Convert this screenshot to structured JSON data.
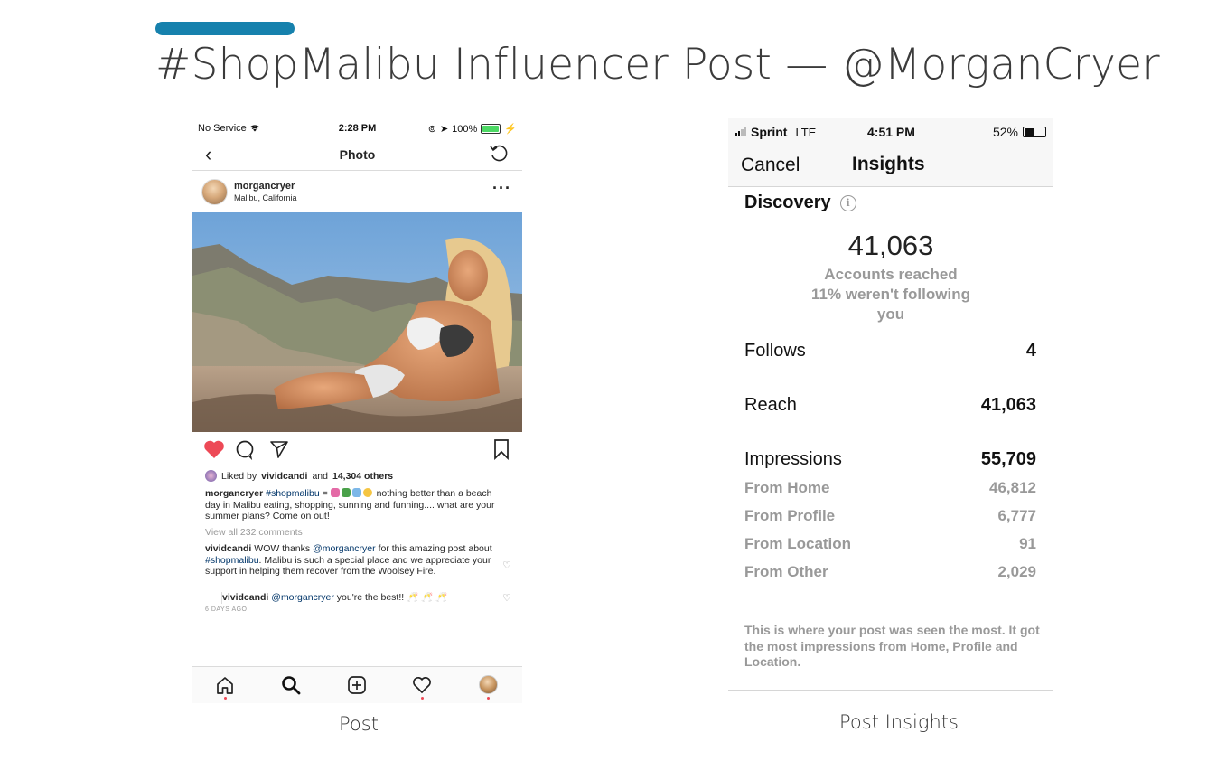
{
  "slide": {
    "title": "#ShopMalibu Influencer Post — @MorganCryer",
    "accent_color": "#1681ad",
    "left_caption": "Post",
    "right_caption": "Post Insights"
  },
  "post_screen": {
    "status": {
      "carrier": "No Service",
      "time": "2:28 PM",
      "battery": "100%"
    },
    "nav_title": "Photo",
    "username": "morgancryer",
    "location": "Malibu, California",
    "likes": {
      "prefix": "Liked by",
      "user": "vividcandi",
      "joiner": "and",
      "count": "14,304 others"
    },
    "caption": {
      "user": "morgancryer",
      "hashtag": "#shopmalibu",
      "eq": "=",
      "text": "nothing better than a beach day in Malibu eating, shopping, sunning and funning.... what are your summer plans?  Come on out!"
    },
    "view_all": "View all 232 comments",
    "comment1": {
      "user": "vividcandi",
      "t1": "WOW thanks",
      "mention": "@morgancryer",
      "t2": "for this amazing post about",
      "hashtag": "#shopmalibu",
      "t3": ". Malibu is such a special place and we appreciate your support in helping them recover from the Woolsey Fire."
    },
    "reply": {
      "user": "vividcandi",
      "mention": "@morgancryer",
      "text": "you're the best!! 🥂 🥂 🥂"
    },
    "timestamp": "6 DAYS AGO",
    "heart_color": "#ed4956"
  },
  "insights_screen": {
    "status": {
      "carrier": "Sprint",
      "network": "LTE",
      "time": "4:51 PM",
      "battery": "52%"
    },
    "cancel": "Cancel",
    "title": "Insights",
    "section": "Discovery",
    "accounts_reached": "41,063",
    "accounts_reached_label": "Accounts reached",
    "not_following_label": "11% weren't following you",
    "rows": [
      {
        "label": "Follows",
        "value": "4"
      },
      {
        "label": "Reach",
        "value": "41,063"
      },
      {
        "label": "Impressions",
        "value": "55,709"
      }
    ],
    "sub_rows": [
      {
        "label": "From Home",
        "value": "46,812"
      },
      {
        "label": "From Profile",
        "value": "6,777"
      },
      {
        "label": "From Location",
        "value": "91"
      },
      {
        "label": "From Other",
        "value": "2,029"
      }
    ],
    "note": "This is where your post was seen the most. It got the most impressions from Home, Profile and Location."
  }
}
